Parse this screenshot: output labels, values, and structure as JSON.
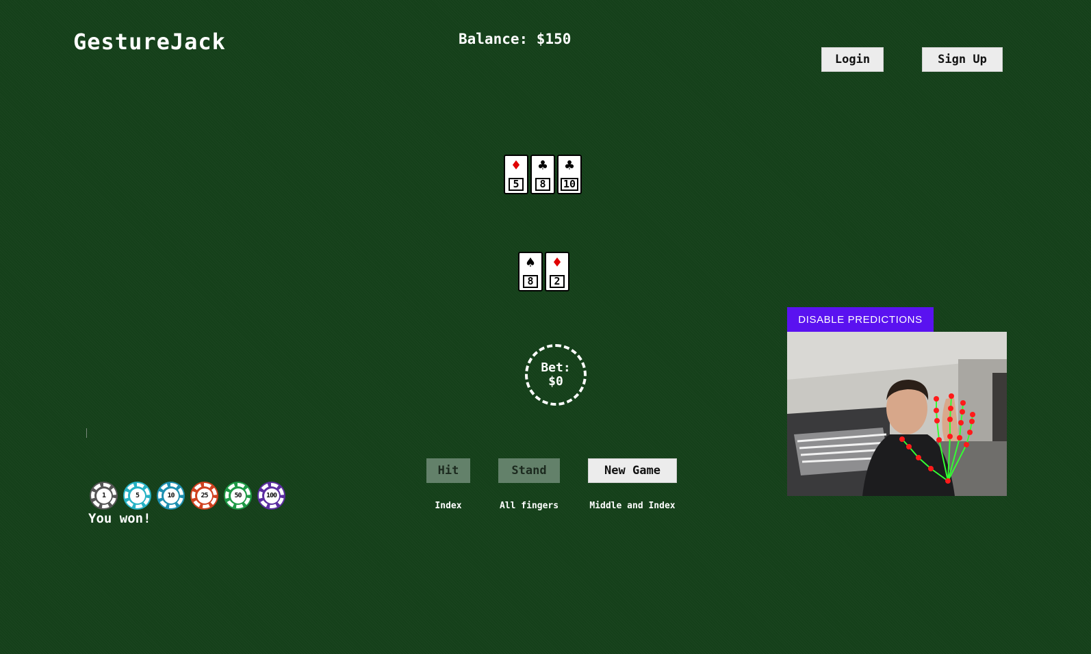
{
  "header": {
    "title": "GestureJack",
    "balance": "Balance: $150",
    "login_label": "Login",
    "signup_label": "Sign Up"
  },
  "dealer_hand": [
    {
      "suit": "♦",
      "rank": "5",
      "color": "#e00000"
    },
    {
      "suit": "♣",
      "rank": "8",
      "color": "#000000"
    },
    {
      "suit": "♣",
      "rank": "10",
      "color": "#000000"
    }
  ],
  "player_hand": [
    {
      "suit": "♠",
      "rank": "8",
      "color": "#000000"
    },
    {
      "suit": "♦",
      "rank": "2",
      "color": "#e00000"
    }
  ],
  "bet": {
    "label": "Bet:",
    "amount": "$0"
  },
  "actions": {
    "hit": "Hit",
    "stand": "Stand",
    "new_game": "New Game",
    "hit_hint": "Index",
    "stand_hint": "All fingers",
    "new_game_hint": "Middle and Index"
  },
  "chips": [
    {
      "value": "1",
      "color": "#555555"
    },
    {
      "value": "5",
      "color": "#26b2c4"
    },
    {
      "value": "10",
      "color": "#1d8fb0"
    },
    {
      "value": "25",
      "color": "#d0411f"
    },
    {
      "value": "50",
      "color": "#1e9a46"
    },
    {
      "value": "100",
      "color": "#5b2ea0"
    }
  ],
  "status": "You won!",
  "webcam": {
    "button_label": "DISABLE PREDICTIONS"
  },
  "colors": {
    "table": "#15401a",
    "accent": "#5a12f0",
    "landmark": "#ff1a1a",
    "skeleton": "#33ff33"
  }
}
